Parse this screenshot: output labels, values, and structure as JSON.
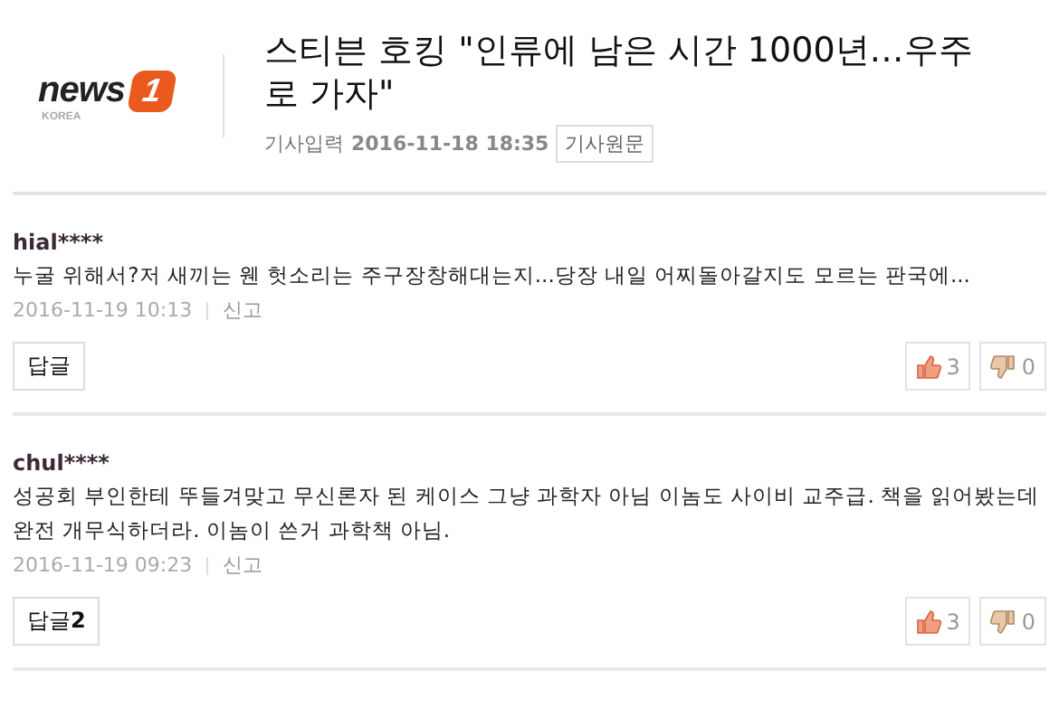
{
  "logo": {
    "wordmark": "news",
    "digit": "1",
    "subtitle": "KOREA"
  },
  "article": {
    "title": "스티븐 호킹 \"인류에 남은 시간 1000년…우주로 가자\"",
    "date_label": "기사입력",
    "date": "2016-11-18 18:35",
    "source_button": "기사원문"
  },
  "comments": [
    {
      "user": "hial****",
      "text": "누굴 위해서?저 새끼는 웬 헛소리는 주구장창해대는지...당장 내일 어찌돌아갈지도 모르는 판국에...",
      "time": "2016-11-19 10:13",
      "report": "신고",
      "reply_label": "답글",
      "likes": "3",
      "dislikes": "0"
    },
    {
      "user": "chul****",
      "text": "성공회 부인한테 뚜들겨맞고 무신론자 된 케이스 그냥 과학자 아님 이놈도 사이비 교주급. 책을 읽어봤는데 완전 개무식하더라. 이놈이 쓴거 과학책 아님.",
      "time": "2016-11-19 09:23",
      "report": "신고",
      "reply_label": "답글",
      "reply_count": "2",
      "likes": "3",
      "dislikes": "0"
    }
  ]
}
